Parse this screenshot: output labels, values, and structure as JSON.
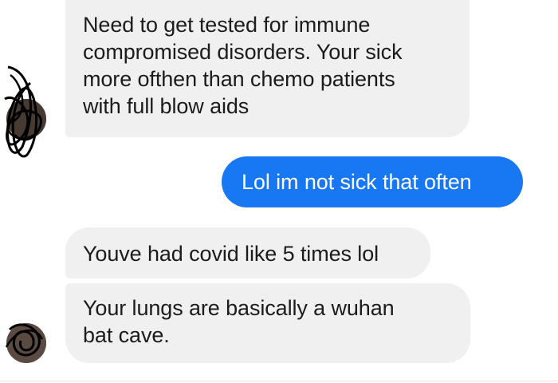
{
  "conversation": {
    "messages": [
      {
        "direction": "incoming",
        "lines": [
          "Need to get tested for immune",
          "compromised disorders. Your sick",
          "more ofthen than chemo patients",
          "with full blow aids"
        ]
      },
      {
        "direction": "outgoing",
        "lines": [
          "Lol im not sick that often"
        ]
      },
      {
        "direction": "incoming",
        "lines": [
          "Youve had covid like 5 times lol"
        ]
      },
      {
        "direction": "incoming",
        "lines": [
          "Your lungs are basically a wuhan",
          "bat cave."
        ]
      }
    ]
  },
  "colors": {
    "incoming_bubble": "#f0f0f0",
    "outgoing_bubble": "#1877f2",
    "incoming_text": "#1c1c1c",
    "outgoing_text": "#ffffff"
  },
  "icons": {
    "avatar1": "avatar-scribbled-out",
    "avatar2": "avatar-scribbled-out"
  }
}
